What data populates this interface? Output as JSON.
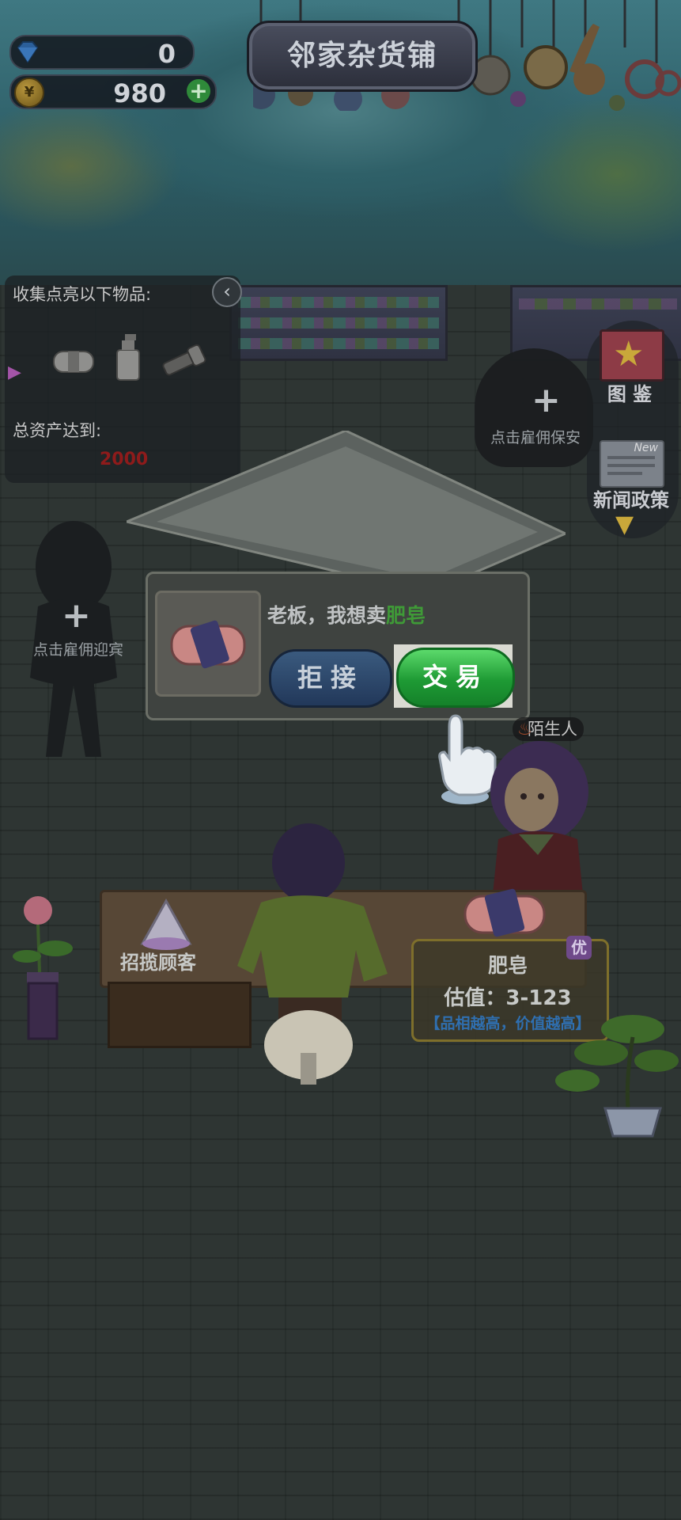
{
  "hud": {
    "gems": "0",
    "coins": "980"
  },
  "title": "邻家杂货铺",
  "task_panel": {
    "collect_label": "收集点亮以下物品:",
    "items": [
      "soap-icon",
      "spray-bottle-icon",
      "flashlight-icon"
    ],
    "assets_label": "总资产达到:",
    "assets_target": "2000"
  },
  "side_buttons": {
    "atlas_label": "图 鉴",
    "news_label": "新闻政策",
    "news_badge": "New"
  },
  "hire_slots": {
    "guard_label": "点击雇佣保安",
    "greeter_label": "点击雇佣迎宾"
  },
  "dialog": {
    "message_prefix": "老板，我想卖",
    "item_name": "肥皂",
    "reject_label": "拒接",
    "trade_label": "交易"
  },
  "customer": {
    "tag": "陌生人"
  },
  "counter": {
    "solicit_label": "招揽顾客"
  },
  "appraisal": {
    "item_name": "肥皂",
    "value": "估值：3-123",
    "note": "【品相越高，价值越高】",
    "grade": "优"
  },
  "colors": {
    "accent_green": "#3f9a37",
    "assets_red": "#8e1b1b",
    "note_blue": "#2f6fb0"
  }
}
